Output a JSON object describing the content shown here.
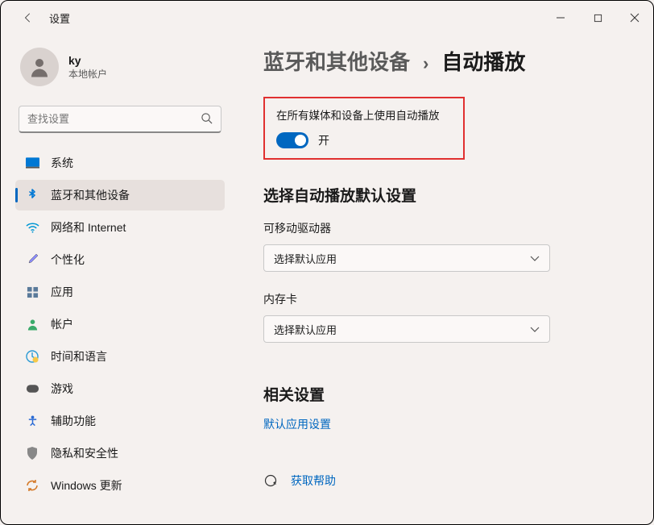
{
  "titlebar": {
    "title": "设置"
  },
  "account": {
    "name": "ky",
    "type": "本地帐户"
  },
  "search": {
    "placeholder": "查找设置"
  },
  "nav": {
    "items": [
      {
        "label": "系统"
      },
      {
        "label": "蓝牙和其他设备"
      },
      {
        "label": "网络和 Internet"
      },
      {
        "label": "个性化"
      },
      {
        "label": "应用"
      },
      {
        "label": "帐户"
      },
      {
        "label": "时间和语言"
      },
      {
        "label": "游戏"
      },
      {
        "label": "辅助功能"
      },
      {
        "label": "隐私和安全性"
      },
      {
        "label": "Windows 更新"
      }
    ]
  },
  "breadcrumb": {
    "parent": "蓝牙和其他设备",
    "sep": "›",
    "current": "自动播放"
  },
  "autoplay": {
    "label": "在所有媒体和设备上使用自动播放",
    "toggle_state": "开"
  },
  "defaults": {
    "header": "选择自动播放默认设置",
    "removable": {
      "label": "可移动驱动器",
      "value": "选择默认应用"
    },
    "memcard": {
      "label": "内存卡",
      "value": "选择默认应用"
    }
  },
  "related": {
    "header": "相关设置",
    "link": "默认应用设置"
  },
  "help": {
    "label": "获取帮助"
  }
}
